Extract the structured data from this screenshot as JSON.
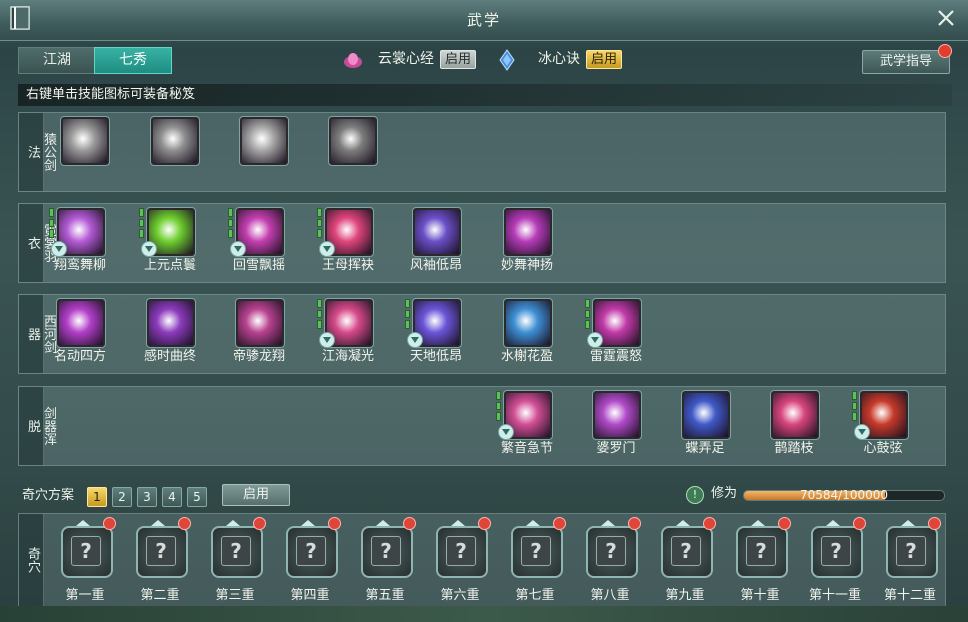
{
  "window": {
    "title": "武学"
  },
  "tabs": [
    {
      "label": "江湖",
      "active": false
    },
    {
      "label": "七秀",
      "active": true
    }
  ],
  "xinfa": [
    {
      "name": "云裳心经",
      "button": "启用",
      "style": "grey"
    },
    {
      "name": "冰心诀",
      "button": "启用",
      "style": "gold"
    }
  ],
  "guide": {
    "label": "武学指导"
  },
  "hint": "右键单击技能图标可装备秘笈",
  "skill_rows": [
    {
      "label": "猿公剑法",
      "skills": [
        {
          "name": "",
          "icon": "mist-swirl-icon",
          "color": "#9a9a9a",
          "bars": 0,
          "arrow": false
        },
        {
          "name": "",
          "icon": "dragon-icon",
          "color": "#8f8f8f",
          "bars": 0,
          "arrow": false
        },
        {
          "name": "",
          "icon": "beast-face-icon",
          "color": "#a6a6a6",
          "bars": 0,
          "arrow": false
        },
        {
          "name": "",
          "icon": "blade-slash-icon",
          "color": "#7d7d7d",
          "bars": 0,
          "arrow": false
        }
      ]
    },
    {
      "label": "霓裳羽衣",
      "skills": [
        {
          "name": "翔鸾舞柳",
          "icon": "dancer-ribbons-icon",
          "color": "#b45bd6",
          "bars": 3,
          "arrow": true
        },
        {
          "name": "上元点鬟",
          "icon": "green-dancer-icon",
          "color": "#6fcf2f",
          "bars": 3,
          "arrow": true
        },
        {
          "name": "回雪飘摇",
          "icon": "snow-swirl-icon",
          "color": "#c43fb0",
          "bars": 3,
          "arrow": true
        },
        {
          "name": "王母挥袂",
          "icon": "fan-sleeve-icon",
          "color": "#e0457c",
          "bars": 3,
          "arrow": true
        },
        {
          "name": "风袖低昂",
          "icon": "lady-figure-icon",
          "color": "#6a4fc8",
          "bars": 0,
          "arrow": false
        },
        {
          "name": "妙舞神扬",
          "icon": "pink-flower-icon",
          "color": "#b63bb8",
          "bars": 0,
          "arrow": false
        }
      ]
    },
    {
      "label": "西河剑器",
      "skills": [
        {
          "name": "名动四方",
          "icon": "spin-dancer-icon",
          "color": "#b23fc9",
          "bars": 0,
          "arrow": false
        },
        {
          "name": "感时曲终",
          "icon": "light-pillar-icon",
          "color": "#8c3bbd",
          "bars": 0,
          "arrow": false
        },
        {
          "name": "帝骖龙翔",
          "icon": "dragon-dance-icon",
          "color": "#b8428f",
          "bars": 0,
          "arrow": false
        },
        {
          "name": "江海凝光",
          "icon": "swirl-lotus-icon",
          "color": "#d64a8a",
          "bars": 3,
          "arrow": true
        },
        {
          "name": "天地低昂",
          "icon": "cross-swords-icon",
          "color": "#6a55d8",
          "bars": 3,
          "arrow": true
        },
        {
          "name": "水榭花盈",
          "icon": "blade-glow-icon",
          "color": "#3e8fd4",
          "bars": 0,
          "arrow": false
        },
        {
          "name": "雷霆震怒",
          "icon": "thunder-icon",
          "color": "#c13aa8",
          "bars": 3,
          "arrow": true
        }
      ]
    },
    {
      "label": "剑器浑脱",
      "skills": [
        {
          "name": "繁音急节",
          "icon": "petal-hand-icon",
          "color": "#d24e95",
          "bars": 3,
          "arrow": true
        },
        {
          "name": "婆罗门",
          "icon": "lotus-bloom-icon",
          "color": "#b04ac8",
          "bars": 0,
          "arrow": false
        },
        {
          "name": "蝶弄足",
          "icon": "butterfly-icon",
          "color": "#3f59c8",
          "bars": 0,
          "arrow": false
        },
        {
          "name": "鹊踏枝",
          "icon": "magpie-dance-icon",
          "color": "#d8457d",
          "bars": 0,
          "arrow": false
        },
        {
          "name": "心鼓弦",
          "icon": "drum-icon",
          "color": "#c73a2a",
          "bars": 3,
          "arrow": true
        }
      ]
    }
  ],
  "qixue_plan": {
    "label": "奇穴方案",
    "options": [
      "1",
      "2",
      "3",
      "4",
      "5"
    ],
    "active": 0,
    "enable": "启用"
  },
  "xiuwei": {
    "label": "修为",
    "text": "70584/100000",
    "current": 70584,
    "max": 100000
  },
  "qixue": {
    "label": "奇穴",
    "slots": [
      "第一重",
      "第二重",
      "第三重",
      "第四重",
      "第五重",
      "第六重",
      "第七重",
      "第八重",
      "第九重",
      "第十重",
      "第十一重",
      "第十二重"
    ]
  }
}
